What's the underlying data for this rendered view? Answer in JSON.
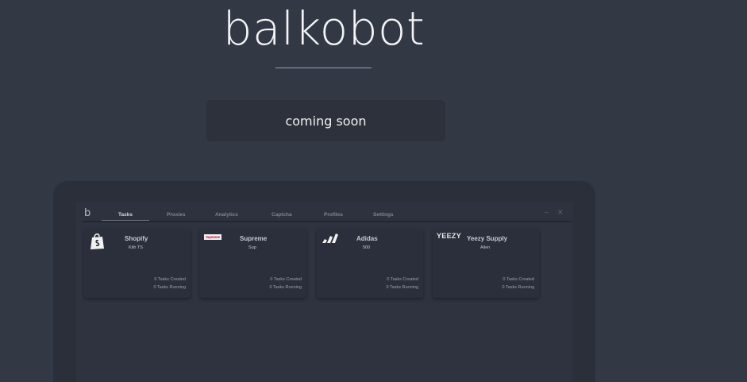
{
  "brand": {
    "title": "balkobot"
  },
  "hero": {
    "button_label": "coming soon"
  },
  "app": {
    "logo_letter": "b",
    "tabs": [
      {
        "label": "Tasks",
        "active": true
      },
      {
        "label": "Proxies",
        "active": false
      },
      {
        "label": "Analytics",
        "active": false
      },
      {
        "label": "Captcha",
        "active": false
      },
      {
        "label": "Profiles",
        "active": false
      },
      {
        "label": "Settings",
        "active": false
      }
    ],
    "window_controls": {
      "minimize": "–",
      "close": "✕"
    },
    "cards": [
      {
        "title": "Shopify",
        "subtitle": "Kith TS",
        "icon": "shopify-bag-icon",
        "tasks_created": "0 Tasks Created",
        "tasks_running": "0 Tasks Running"
      },
      {
        "title": "Supreme",
        "subtitle": "Sup",
        "icon": "supreme-logo",
        "logo_text": "Supreme",
        "tasks_created": "0 Tasks Created",
        "tasks_running": "0 Tasks Running"
      },
      {
        "title": "Adidas",
        "subtitle": "500",
        "icon": "adidas-stripes-icon",
        "tasks_created": "0 Tasks Created",
        "tasks_running": "0 Tasks Running"
      },
      {
        "title": "Yeezy Supply",
        "subtitle": "Alien",
        "icon": "yeezy-logo",
        "logo_text": "YEEZY",
        "tasks_created": "0 Tasks Created",
        "tasks_running": "0 Tasks Running"
      }
    ]
  },
  "colors": {
    "background": "#333845",
    "panel": "#2d313b",
    "card": "#2b2f3b",
    "text": "#f4f4f6",
    "muted": "#7e8493"
  }
}
